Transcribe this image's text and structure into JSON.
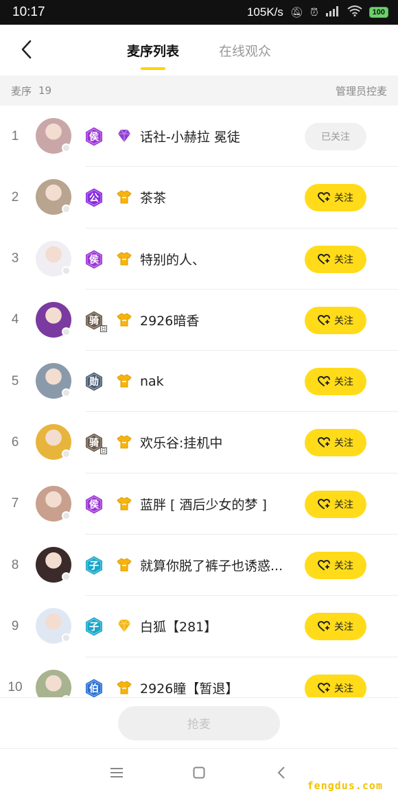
{
  "status_bar": {
    "time": "10:17",
    "speed": "105K/s",
    "battery": "100"
  },
  "header": {
    "tabs": [
      {
        "label": "麦序列表",
        "active": true
      },
      {
        "label": "在线观众",
        "active": false
      }
    ]
  },
  "subbar": {
    "label": "麦序",
    "count": "19",
    "admin": "管理员控麦"
  },
  "follow_label": "关注",
  "followed_label": "已关注",
  "rows": [
    {
      "rank": "1",
      "badge": "侯",
      "badge_color": "#9b35d6",
      "medal": "purple-gem-icon",
      "name": "话社-小赫拉 冕徒",
      "followed": true
    },
    {
      "rank": "2",
      "badge": "公",
      "badge_color": "#8a2be2",
      "medal": "gold-shirt-icon",
      "name": "茶茶",
      "followed": false
    },
    {
      "rank": "3",
      "badge": "侯",
      "badge_color": "#9b35d6",
      "medal": "gold-shirt-icon",
      "name": "特别的人、",
      "followed": false
    },
    {
      "rank": "4",
      "badge": "骑",
      "badge_color": "#6b5a4a",
      "badge_sub": "日",
      "medal": "gold-shirt-icon",
      "name": "2926暗香",
      "followed": false
    },
    {
      "rank": "5",
      "badge": "勋",
      "badge_color": "#4a5d73",
      "medal": "gold-shirt-icon",
      "name": "nak",
      "followed": false
    },
    {
      "rank": "6",
      "badge": "骑",
      "badge_color": "#6b5a4a",
      "badge_sub": "日",
      "medal": "gold-shirt-icon",
      "name": "欢乐谷:挂机中",
      "followed": false
    },
    {
      "rank": "7",
      "badge": "侯",
      "badge_color": "#9b35d6",
      "medal": "gold-shirt-icon",
      "name": "蓝胖 [ 酒后少女的梦 ]",
      "followed": false
    },
    {
      "rank": "8",
      "badge": "子",
      "badge_color": "#19a7c9",
      "medal": "gold-shirt-icon",
      "name": "就算你脱了裤子也诱惑...",
      "followed": false
    },
    {
      "rank": "9",
      "badge": "子",
      "badge_color": "#19a7c9",
      "medal": "gold-gem-icon",
      "name": "白狐【281】",
      "followed": false
    },
    {
      "rank": "10",
      "badge": "伯",
      "badge_color": "#2b6fd6",
      "medal": "gold-shirt-icon",
      "name": "2926瞳【暂退】",
      "followed": false
    }
  ],
  "grab_button": "抢麦",
  "watermark": "fengdus.com",
  "colors": {
    "accent": "#ffdb1a",
    "underline": "#ffd400"
  }
}
